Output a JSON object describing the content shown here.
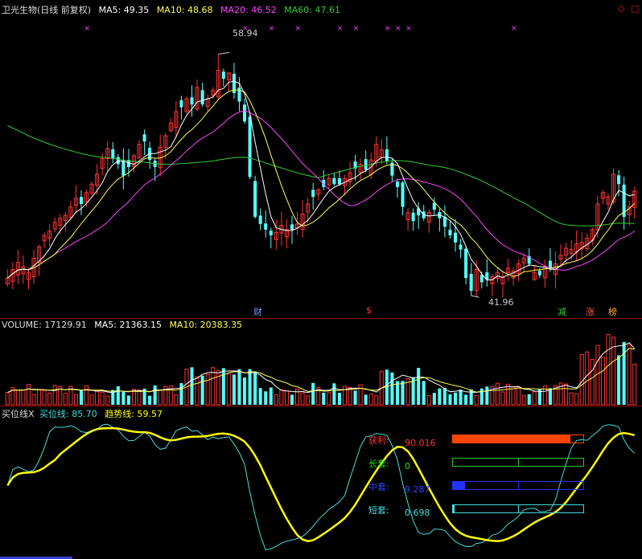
{
  "header": {
    "title": "卫光生物(日线 前复权)",
    "ma5": "MA5: 49.35",
    "ma10": "MA10: 48.68",
    "ma20": "MA20: 46.52",
    "ma60": "MA60: 47.61"
  },
  "volume_header": {
    "volume": "VOLUME: 17129.91",
    "ma5": "MA5: 21363.15",
    "ma10": "MA10: 20383.35"
  },
  "indicator_header": {
    "name": "买位线X",
    "buy_line": "买位线: 85.70",
    "trend_line": "趋势线: 59.57"
  },
  "events": {
    "cai": "财",
    "dollar": "$",
    "jian": "减",
    "zhang": "涨",
    "bang": "榜"
  },
  "price_marks": {
    "high": "58.94",
    "low": "41.96"
  },
  "meters": [
    {
      "label": "获利:",
      "value": "90.016",
      "fraction": 0.9,
      "color": "#ff4400",
      "label_color": "#ff3333"
    },
    {
      "label": "长套:",
      "value": "0",
      "fraction": 0.0,
      "color": "#22cc22",
      "label_color": "#22dd22"
    },
    {
      "label": "中套:",
      "value": "9.287",
      "fraction": 0.09,
      "color": "#2233ff",
      "label_color": "#3344ff"
    },
    {
      "label": "短套:",
      "value": "0.698",
      "fraction": 0.01,
      "color": "#44dddd",
      "label_color": "#44dddd"
    }
  ],
  "colors": {
    "up": "#ff3333",
    "down": "#54ffff",
    "ma5": "#ffffff",
    "ma10": "#ffff55",
    "ma20": "#ff44ff",
    "ma60": "#33cc33",
    "buy_line": "#44dddd",
    "trend_line": "#ffff00"
  },
  "chart_data": [
    {
      "type": "candlestick",
      "title": "卫光生物(日线 前复权)",
      "n_bars": 120,
      "marked_high": 58.94,
      "marked_low": 41.96,
      "ylim": [
        40.5,
        61.5
      ],
      "close": [
        43.2,
        43.8,
        44.3,
        44.0,
        43.6,
        44.6,
        45.4,
        46.2,
        46.5,
        47.1,
        47.4,
        47.6,
        48.2,
        48.8,
        48.4,
        49.2,
        49.8,
        50.5,
        51.6,
        52.3,
        51.6,
        51.2,
        50.4,
        51.0,
        51.8,
        52.6,
        52.8,
        51.5,
        51.0,
        52.4,
        53.2,
        54.1,
        54.9,
        55.2,
        55.8,
        55.4,
        56.6,
        55.4,
        55.8,
        56.4,
        57.8,
        57.2,
        57.6,
        56.2,
        55.6,
        54.2,
        50.3,
        47.5,
        47.0,
        46.6,
        46.2,
        46.4,
        46.9,
        46.6,
        46.6,
        47.0,
        47.7,
        48.4,
        48.9,
        49.4,
        49.6,
        50.2,
        49.8,
        49.8,
        50.2,
        50.6,
        50.9,
        51.2,
        50.8,
        51.5,
        52.6,
        52.2,
        51.4,
        50.4,
        49.6,
        48.2,
        47.8,
        47.2,
        47.6,
        47.4,
        47.8,
        48.0,
        47.4,
        46.8,
        46.2,
        45.7,
        45.2,
        43.2,
        42.3,
        43.8,
        42.9,
        43.1,
        43.3,
        43.6,
        43.3,
        43.9,
        43.7,
        44.2,
        44.6,
        44.2,
        43.6,
        43.4,
        44.0,
        43.9,
        44.2,
        44.8,
        45.3,
        45.2,
        45.6,
        45.7,
        46.0,
        46.6,
        48.4,
        49.2,
        48.9,
        50.5,
        49.8,
        47.5,
        48.2,
        49.3
      ],
      "series": [
        {
          "name": "MA5",
          "value": 49.35
        },
        {
          "name": "MA10",
          "value": 48.68
        },
        {
          "name": "MA20",
          "value": 46.52
        },
        {
          "name": "MA60",
          "value": 47.61
        }
      ]
    },
    {
      "type": "bar",
      "title": "VOLUME",
      "volume": 17129.91,
      "series": [
        {
          "name": "MA5",
          "value": 21363.15
        },
        {
          "name": "MA10",
          "value": 20383.35
        }
      ]
    },
    {
      "type": "line",
      "title": "买位线X",
      "series": [
        {
          "name": "买位线",
          "value": 85.7
        },
        {
          "name": "趋势线",
          "value": 59.57
        }
      ]
    }
  ]
}
